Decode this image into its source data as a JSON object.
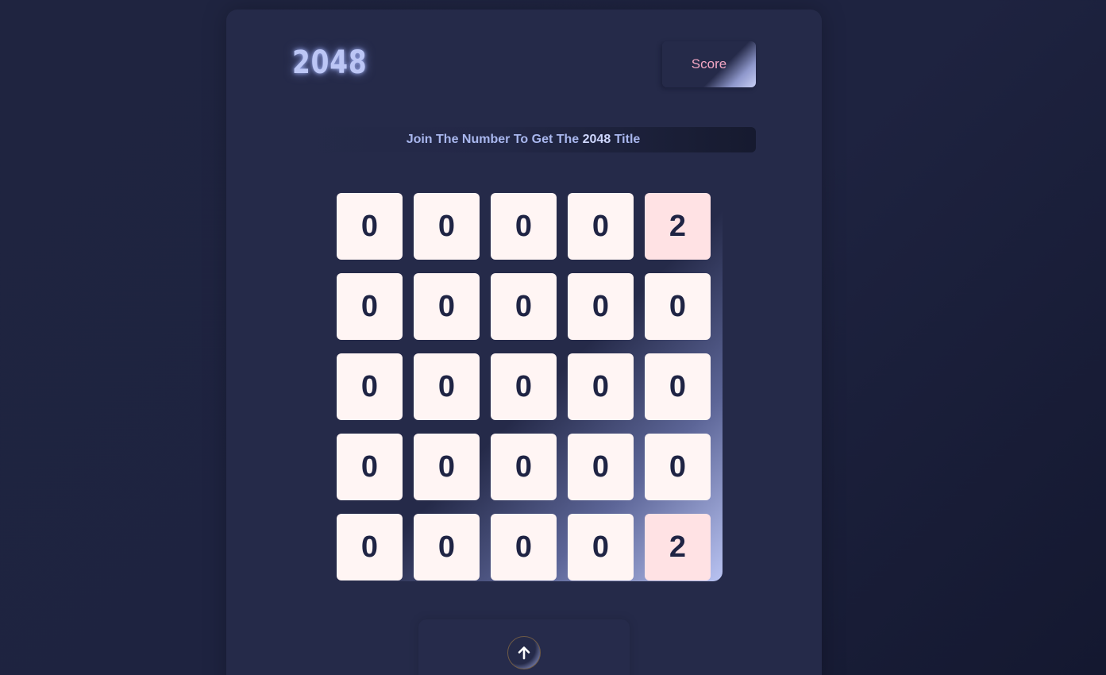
{
  "game": {
    "title": "2048",
    "score_label": "Score",
    "banner": {
      "prefix": "Join The Number To Get The",
      "highlight": "2048",
      "suffix": "Title"
    }
  },
  "board": {
    "rows": [
      [
        "0",
        "0",
        "0",
        "0",
        "2"
      ],
      [
        "0",
        "0",
        "0",
        "0",
        "0"
      ],
      [
        "0",
        "0",
        "0",
        "0",
        "0"
      ],
      [
        "0",
        "0",
        "0",
        "0",
        "0"
      ],
      [
        "0",
        "0",
        "0",
        "0",
        "2"
      ]
    ]
  },
  "controls": {
    "up_icon": "arrow-up-icon"
  },
  "colors": {
    "background": "#1e2340",
    "panel": "#252a49",
    "tile_empty": "#fff5f4",
    "tile_filled": "#ffe2e4",
    "tile_text": "#1f2444",
    "logo": "#bcc6f5",
    "score_text": "#f3a7c4",
    "banner_text": "#a9b7ee"
  }
}
